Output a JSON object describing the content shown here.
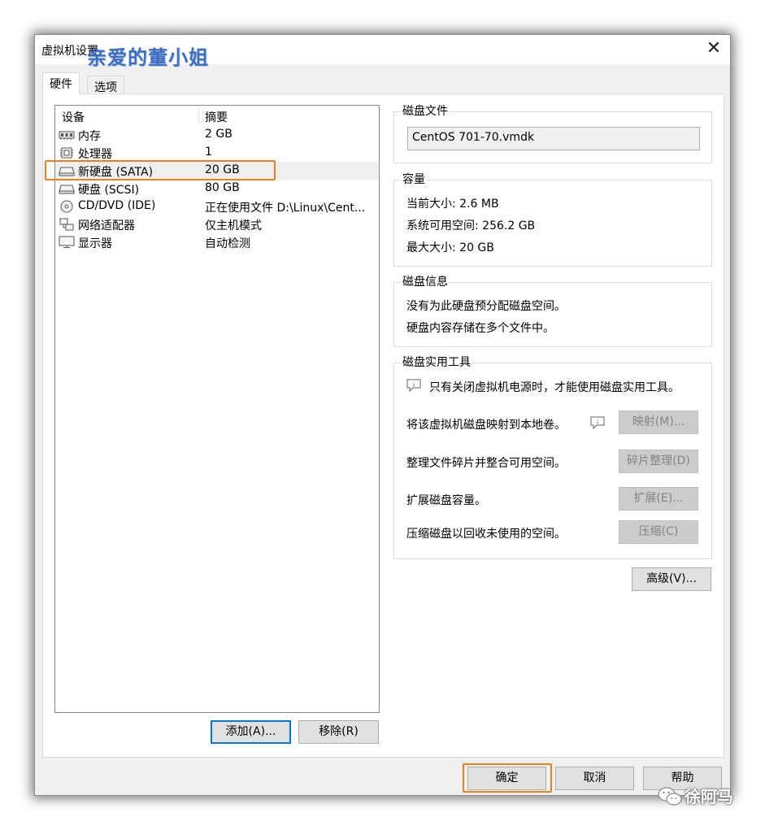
{
  "window": {
    "title": "虚拟机设置",
    "watermark": "亲爱的董小姐",
    "close_glyph": "✕"
  },
  "tabs": [
    {
      "label": "硬件",
      "active": true
    },
    {
      "label": "选项",
      "active": false
    }
  ],
  "device_list": {
    "columns": [
      "设备",
      "摘要"
    ],
    "rows": [
      {
        "icon": "memory-icon",
        "name": "内存",
        "summary": "2 GB"
      },
      {
        "icon": "processor-icon",
        "name": "处理器",
        "summary": "1"
      },
      {
        "icon": "hard-disk-icon",
        "name": "新硬盘 (SATA)",
        "summary": "20 GB",
        "selected": true
      },
      {
        "icon": "hard-disk-icon",
        "name": "硬盘 (SCSI)",
        "summary": "80 GB"
      },
      {
        "icon": "cd-dvd-icon",
        "name": "CD/DVD (IDE)",
        "summary": "正在使用文件 D:\\Linux\\Cent..."
      },
      {
        "icon": "network-adapter-icon",
        "name": "网络适配器",
        "summary": "仅主机模式"
      },
      {
        "icon": "display-icon",
        "name": "显示器",
        "summary": "自动检测"
      }
    ],
    "add_button": "添加(A)...",
    "remove_button": "移除(R)"
  },
  "disk_file": {
    "title": "磁盘文件",
    "value": "CentOS 701-70.vmdk"
  },
  "capacity": {
    "title": "容量",
    "current_size": "当前大小: 2.6 MB",
    "system_available": "系统可用空间: 256.2 GB",
    "max_size": "最大大小: 20 GB"
  },
  "disk_info": {
    "title": "磁盘信息",
    "line1": "没有为此硬盘预分配磁盘空间。",
    "line2": "硬盘内容存储在多个文件中。"
  },
  "disk_utilities": {
    "title": "磁盘实用工具",
    "notice": "只有关闭虚拟机电源时，才能使用磁盘实用工具。",
    "map_text": "将该虚拟机磁盘映射到本地卷。",
    "map_button": "映射(M)...",
    "defrag_text": "整理文件碎片并整合可用空间。",
    "defrag_button": "碎片整理(D)",
    "expand_text": "扩展磁盘容量。",
    "expand_button": "扩展(E)...",
    "compact_text": "压缩磁盘以回收未使用的空间。",
    "compact_button": "压缩(C)"
  },
  "advanced_button": "高级(V)...",
  "footer": {
    "ok": "确定",
    "cancel": "取消",
    "help": "帮助"
  },
  "overlay": {
    "wechat_label": "徐阿马"
  },
  "colors": {
    "highlight": "#ef7d22",
    "default_button_border": "#0078d7",
    "watermark": "#2b5fb8"
  }
}
